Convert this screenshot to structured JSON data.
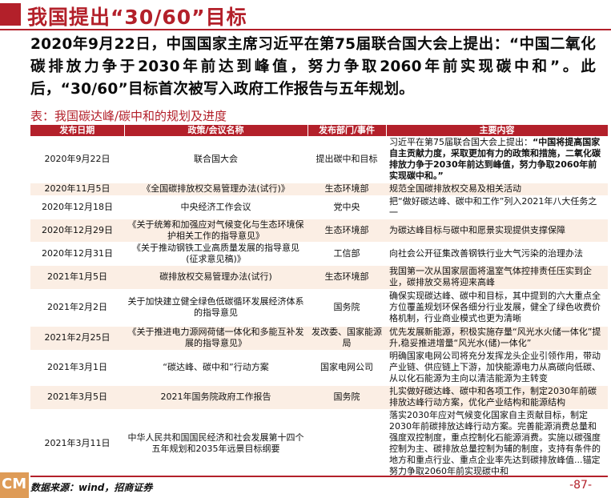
{
  "page_title": "我国提出“30/60”目标",
  "intro": "2020年9月22日，中国国家主席习近平在第75届联合国大会上提出：“中国二氧化碳排放力争于2030年前达到峰值，努力争取2060年前实现碳中和”。此后，“30/60”目标首次被写入政府工作报告与五年规划。",
  "table_caption": "表：我国碳达峰/碳中和的规划及进度",
  "table": {
    "headers": [
      "发布日期",
      "政策/会议名称",
      "发布部门/事件",
      "主要内容"
    ],
    "rows": [
      {
        "date": "2020年9月22日",
        "name": "联合国大会",
        "dept": "提出碳中和目标",
        "content_plain": "习近平在第75届联合国大会上提出：",
        "content_bold": "“中国将提高国家自主贡献力度，采取更加有力的政策和措施，二氧化碳排放力争于2030年前达到峰值，努力争取2060年前实现碳中和。”"
      },
      {
        "date": "2020年11月5日",
        "name": "《全国碳排放权交易管理办法(试行)》",
        "dept": "生态环境部",
        "content_plain": "规范全国碳排放权交易及相关活动",
        "content_bold": ""
      },
      {
        "date": "2020年12月18日",
        "name": "中央经济工作会议",
        "dept": "党中央",
        "content_plain": "把“做好碳达峰、碳中和工作”列入2021年八大任务之一",
        "content_bold": ""
      },
      {
        "date": "2020年12月29日",
        "name": "《关于统筹和加强应对气候变化与生态环境保护相关工作的指导意见》",
        "dept": "生态环境部",
        "content_plain": "为碳达峰目标与碳中和愿景实现提供支撑保障",
        "content_bold": ""
      },
      {
        "date": "2020年12月31日",
        "name": "《关于推动钢铁工业高质量发展的指导意见(征求意见稿)》",
        "dept": "工信部",
        "content_plain": "向社会公开征集改善钢铁行业大气污染的治理办法",
        "content_bold": ""
      },
      {
        "date": "2021年1月5日",
        "name": "碳排放权交易管理办法(试行)",
        "dept": "生态环境部",
        "content_plain": "我国第一次从国家层面将温室气体控排责任压实到企业，碳排放交易将迎来高峰",
        "content_bold": ""
      },
      {
        "date": "2021年2月2日",
        "name": "关于加快建立健全绿色低碳循环发展经济体系的指导意见",
        "dept": "国务院",
        "content_plain": "确保实现碳达峰、碳中和目标，其中提到的六大重点全方位覆盖规划环保各细分行业发展，健全了绿色收费价格机制，行业商业模式也更为清晰",
        "content_bold": ""
      },
      {
        "date": "2021年2月25日",
        "name": "《关于推进电力源网荷储一体化和多能互补发展的指导意见》",
        "dept": "发改委、国家能源局",
        "content_plain": "优先发展新能源，积极实施存量“风光水火储一体化”提升,稳妥推进增量“风光水(储)一体化”",
        "content_bold": ""
      },
      {
        "date": "2021年3月1日",
        "name": "“碳达峰、碳中和”行动方案",
        "dept": "国家电网公司",
        "content_plain": "明确国家电网公司将充分发挥龙头企业引领作用，带动产业链、供应链上下游，加快能源电力从高碳向低碳、从以化石能源为主向以清洁能源为主转变",
        "content_bold": ""
      },
      {
        "date": "2021年3月5日",
        "name": "2021年国务院政府工作报告",
        "dept": "国务院",
        "content_plain": "扎实做好碳达峰、碳中和各项工作，制定2030年前碳排放达峰行动方案，优化产业结构和能源结构",
        "content_bold": ""
      },
      {
        "date": "2021年3月11日",
        "name": "中华人民共和国国民经济和社会发展第十四个五年规划和2035年远景目标纲要",
        "dept": "",
        "content_plain": "落实2030年应对气候变化国家自主贡献目标，制定2030年前碳排放达峰行动方案。完善能源消费总量和强度双控制度，重点控制化石能源消费。实施以碳强度控制为主、碳排放总量控制为辅的制度，支持有条件的地方和重点行业、重点企业率先达到碳排放峰值...锚定努力争取2060年前实现碳中和",
        "content_bold": ""
      }
    ]
  },
  "footer": {
    "source": "数据来源：wind，招商证券",
    "page_number": "-87-",
    "logo_text": "CM"
  },
  "colors": {
    "accent": "#b3202a",
    "row_alt": "#fbeee4"
  }
}
